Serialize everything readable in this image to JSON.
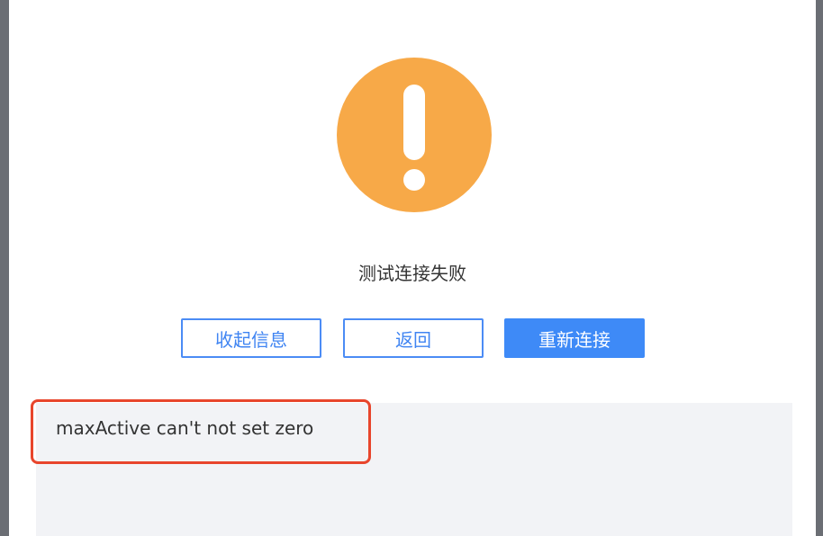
{
  "dialog": {
    "icon": "warning-exclamation-icon",
    "icon_color": "#f7a948",
    "status_text": "测试连接失败",
    "buttons": {
      "collapse_label": "收起信息",
      "back_label": "返回",
      "reconnect_label": "重新连接"
    },
    "error_details": "maxActive can't not set zero",
    "accent_color": "#3e8af7",
    "highlight_color": "#e8452c"
  }
}
